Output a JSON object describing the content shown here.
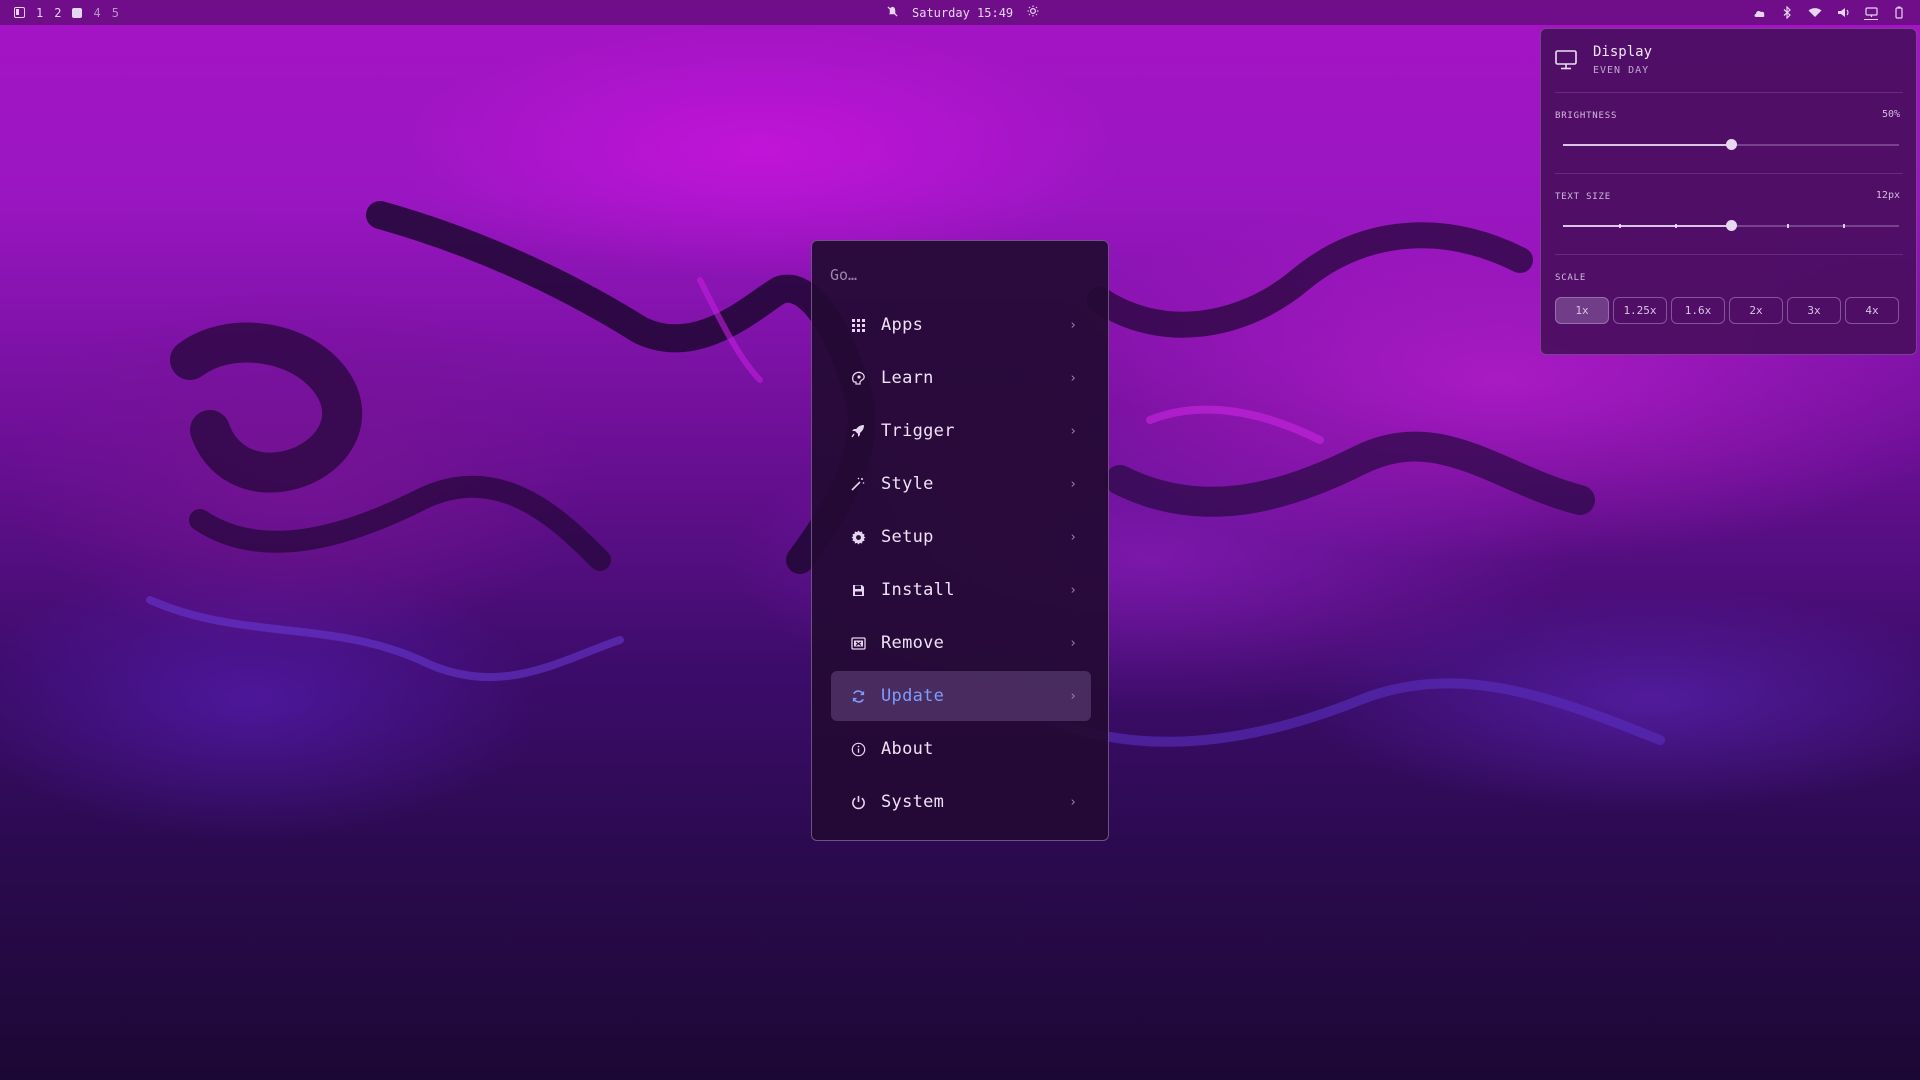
{
  "topbar": {
    "workspaces": [
      "1",
      "2",
      "4",
      "5"
    ],
    "clock": "Saturday 15:49",
    "tray_icons": [
      "cloud-icon",
      "bluetooth-icon",
      "wifi-icon",
      "volume-icon",
      "display-icon",
      "battery-icon"
    ]
  },
  "menu": {
    "placeholder": "Go…",
    "items": [
      {
        "label": "Apps",
        "icon": "grid-icon",
        "has_submenu": true
      },
      {
        "label": "Learn",
        "icon": "learn-icon",
        "has_submenu": true
      },
      {
        "label": "Trigger",
        "icon": "rocket-icon",
        "has_submenu": true
      },
      {
        "label": "Style",
        "icon": "magic-wand-icon",
        "has_submenu": true
      },
      {
        "label": "Setup",
        "icon": "gear-icon",
        "has_submenu": true
      },
      {
        "label": "Install",
        "icon": "save-icon",
        "has_submenu": true
      },
      {
        "label": "Remove",
        "icon": "remove-icon",
        "has_submenu": true
      },
      {
        "label": "Update",
        "icon": "refresh-icon",
        "has_submenu": true,
        "active": true
      },
      {
        "label": "About",
        "icon": "info-icon",
        "has_submenu": false
      },
      {
        "label": "System",
        "icon": "power-icon",
        "has_submenu": true
      }
    ],
    "active_color": "#7d9cff"
  },
  "display_panel": {
    "title": "Display",
    "subtitle": "EVEN DAY",
    "brightness": {
      "label": "BRIGHTNESS",
      "value_text": "50%",
      "value": 0.5
    },
    "text_size": {
      "label": "TEXT SIZE",
      "value_text": "12px",
      "value": 0.5,
      "steps": 6
    },
    "scale": {
      "label": "SCALE",
      "options": [
        "1x",
        "1.25x",
        "1.6x",
        "2x",
        "3x",
        "4x"
      ],
      "selected": "1x"
    }
  }
}
